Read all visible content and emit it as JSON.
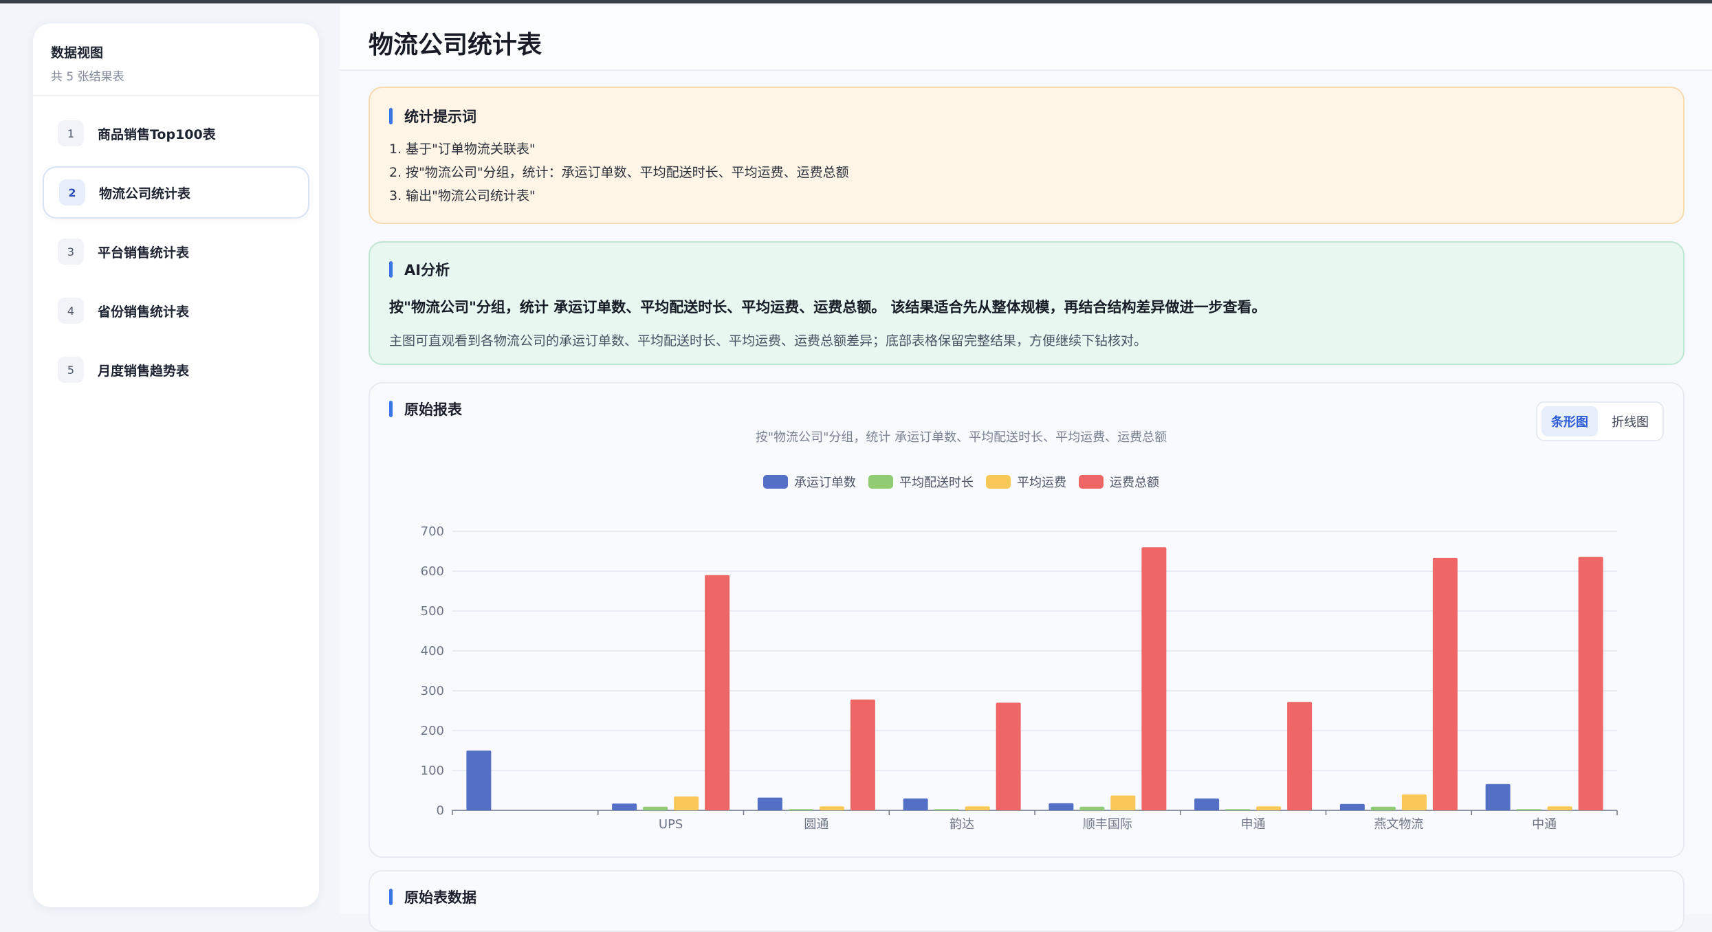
{
  "sidebar": {
    "title": "数据视图",
    "subtitle": "共 5 张结果表",
    "items": [
      {
        "num": "1",
        "label": "商品销售Top100表"
      },
      {
        "num": "2",
        "label": "物流公司统计表"
      },
      {
        "num": "3",
        "label": "平台销售统计表"
      },
      {
        "num": "4",
        "label": "省份销售统计表"
      },
      {
        "num": "5",
        "label": "月度销售趋势表"
      }
    ],
    "active_index": 1
  },
  "page": {
    "title": "物流公司统计表"
  },
  "tips": {
    "title": "统计提示词",
    "lines": [
      "1. 基于\"订单物流关联表\"",
      "2. 按\"物流公司\"分组，统计：承运订单数、平均配送时长、平均运费、运费总额",
      "3. 输出\"物流公司统计表\""
    ]
  },
  "ai": {
    "title": "AI分析",
    "headline": "按\"物流公司\"分组，统计 承运订单数、平均配送时长、平均运费、运费总额。 该结果适合先从整体规模，再结合结构差异做进一步查看。",
    "text": "主图可直观看到各物流公司的承运订单数、平均配送时长、平均运费、运费总额差异；底部表格保留完整结果，方便继续下钻核对。"
  },
  "chart_card": {
    "title": "原始报表",
    "subtitle": "按\"物流公司\"分组，统计 承运订单数、平均配送时长、平均运费、运费总额",
    "toggle": {
      "bar": "条形图",
      "line": "折线图"
    }
  },
  "chart_data": {
    "type": "bar",
    "categories": [
      "",
      "UPS",
      "圆通",
      "韵达",
      "顺丰国际",
      "申通",
      "燕文物流",
      "中通"
    ],
    "ylim": [
      0,
      700
    ],
    "yticks": [
      0,
      100,
      200,
      300,
      400,
      500,
      600,
      700
    ],
    "grid": true,
    "legend_position": "top",
    "series": [
      {
        "name": "承运订单数",
        "color": "#5470c6",
        "values": [
          150,
          17,
          32,
          30,
          18,
          30,
          16,
          66
        ]
      },
      {
        "name": "平均配送时长",
        "color": "#91cc75",
        "values": [
          0,
          9,
          3,
          3,
          9,
          3,
          9,
          3
        ]
      },
      {
        "name": "平均运费",
        "color": "#fac858",
        "values": [
          0,
          35,
          10,
          10,
          37,
          10,
          40,
          10
        ]
      },
      {
        "name": "运费总额",
        "color": "#ee6666",
        "values": [
          0,
          590,
          278,
          270,
          660,
          272,
          633,
          636
        ]
      }
    ]
  },
  "data_card": {
    "title": "原始表数据"
  }
}
